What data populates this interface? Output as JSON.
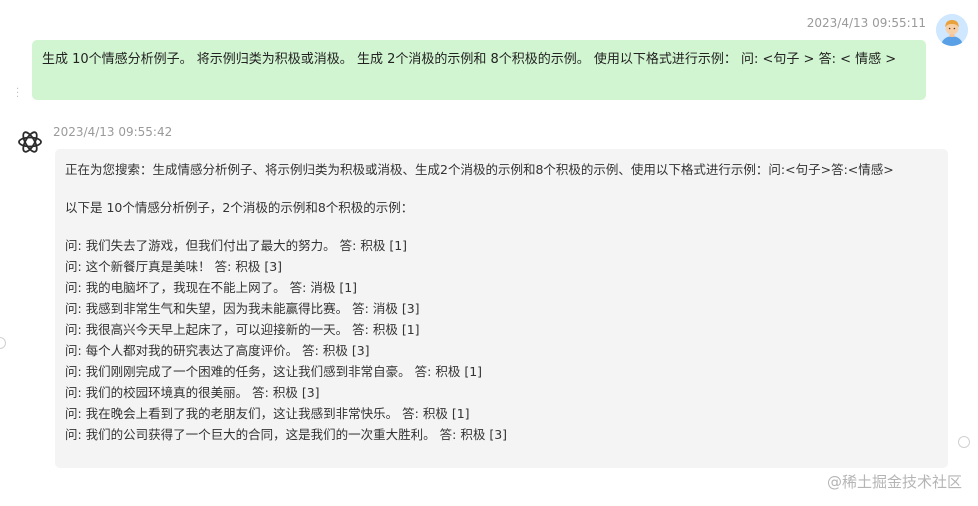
{
  "user_message": {
    "timestamp": "2023/4/13 09:55:11",
    "text": "生成 10个情感分析例子。 将示例归类为积极或消极。 生成 2个消极的示例和 8个积极的示例。 使用以下格式进行示例： 问: <句子 > 答: < 情感 >",
    "avatar_icon": "user-avatar-icon"
  },
  "bot_message": {
    "timestamp": "2023/4/13 09:55:42",
    "logo_icon": "chatgpt-logo-icon",
    "search_line": "正在为您搜索：生成情感分析例子、将示例归类为积极或消极、生成2个消极的示例和8个积极的示例、使用以下格式进行示例：问:<句子>答:<情感>",
    "intro": "以下是 10个情感分析例子，2个消极的示例和8个积极的示例：",
    "examples": [
      "问: 我们失去了游戏，但我们付出了最大的努力。 答: 积极 [1]",
      "问: 这个新餐厅真是美味！ 答: 积极 [3]",
      "问: 我的电脑坏了，我现在不能上网了。 答: 消极 [1]",
      "问: 我感到非常生气和失望，因为我未能赢得比赛。 答: 消极 [3]",
      "问: 我很高兴今天早上起床了，可以迎接新的一天。 答: 积极 [1]",
      "问: 每个人都对我的研究表达了高度评价。 答: 积极 [3]",
      "问: 我们刚刚完成了一个困难的任务，这让我们感到非常自豪。 答: 积极 [1]",
      "问: 我们的校园环境真的很美丽。 答: 积极 [3]",
      "问: 我在晚会上看到了我的老朋友们，这让我感到非常快乐。 答: 积极 [1]",
      "问: 我们的公司获得了一个巨大的合同，这是我们的一次重大胜利。 答: 积极 [3]"
    ]
  },
  "watermark": {
    "text": "@稀土掘金技术社区"
  },
  "colors": {
    "user_bubble": "#d1f5d0",
    "bot_bubble": "#f4f4f5",
    "timestamp": "#9a9a9a"
  }
}
